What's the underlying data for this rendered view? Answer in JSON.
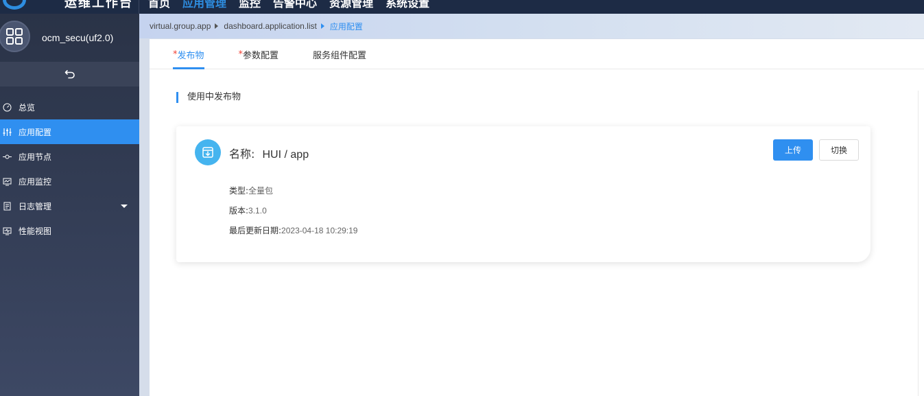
{
  "app": {
    "logo_text": "运维工作台",
    "top_nav": [
      "首页",
      "应用管理",
      "监控",
      "告警中心",
      "资源管理",
      "系统设置"
    ]
  },
  "sidebar": {
    "username": "ocm_secu(uf2.0)",
    "items": [
      {
        "label": "总览",
        "icon": "gauge-icon"
      },
      {
        "label": "应用配置",
        "icon": "sliders-icon"
      },
      {
        "label": "应用节点",
        "icon": "node-icon"
      },
      {
        "label": "应用监控",
        "icon": "monitor-icon"
      },
      {
        "label": "日志管理",
        "icon": "log-icon"
      },
      {
        "label": "性能视图",
        "icon": "chart-icon"
      }
    ]
  },
  "breadcrumb": {
    "items": [
      "virtual.group.app",
      "dashboard.application.list",
      "应用配置"
    ]
  },
  "tabs": [
    {
      "label": "发布物",
      "required": "*"
    },
    {
      "label": "参数配置",
      "required": "*"
    },
    {
      "label": "服务组件配置",
      "required": ""
    }
  ],
  "section": {
    "title": "使用中发布物"
  },
  "card": {
    "name_label": "名称:",
    "name_value": "HUI / app",
    "upload_label": "上传",
    "switch_label": "切换",
    "type_label": "类型:",
    "type_value": "全量包",
    "version_label": "版本:",
    "version_value": "3.1.0",
    "updated_label": "最后更新日期:",
    "updated_value": "2023-04-18 10:29:19"
  },
  "colors": {
    "accent": "#2f8ff0",
    "sidebar_bg": "#2a3347",
    "topbar_bg": "#1d2b45",
    "card_icon": "#45b4ef"
  }
}
